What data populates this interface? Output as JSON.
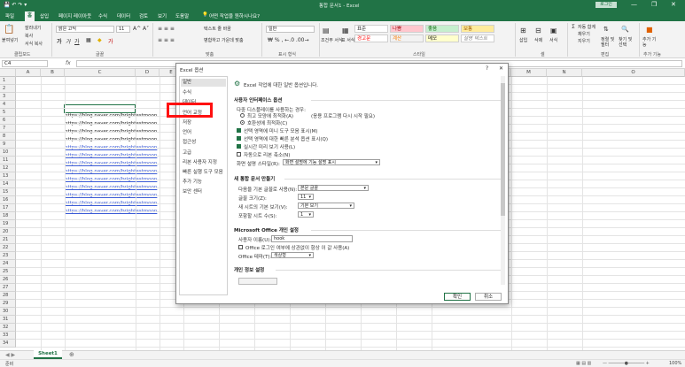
{
  "titlebar": {
    "qa": "💾 ↶ ↷ ▾",
    "title": "통합 문서1 - Excel",
    "login": "로그인",
    "min": "—",
    "max": "❐",
    "close": "✕"
  },
  "tabs": [
    "파일",
    "홈",
    "삽입",
    "페이지 레이아웃",
    "수식",
    "데이터",
    "검토",
    "보기",
    "도움말"
  ],
  "tell_me": "어떤 작업을 원하시나요?",
  "ribbon": {
    "clipboard": {
      "paste": "붙여넣기",
      "cut": "잘라내기",
      "copy": "복사",
      "format_painter": "서식 복사",
      "label": "클립보드"
    },
    "font": {
      "name": "맑은 고딕",
      "size": "11",
      "label": "글꼴"
    },
    "align": {
      "wrap": "텍스트 줄 바꿈",
      "merge": "병합하고 가운데 맞춤",
      "label": "맞춤"
    },
    "number": {
      "format": "일반",
      "label": "표시 형식"
    },
    "styles": {
      "cond": "조건부 서식",
      "table": "표 서식",
      "normal": "표준",
      "bad": "나쁨",
      "good": "좋음",
      "neutral": "보통",
      "warn": "경고문",
      "calc": "계산",
      "memo": "메모",
      "explain": "설명 텍스트",
      "label": "스타일"
    },
    "cells": {
      "insert": "삽입",
      "delete": "삭제",
      "format": "서식",
      "label": "셀"
    },
    "edit": {
      "autosum": "자동 합계",
      "fill": "채우기",
      "clear": "지우기",
      "sort": "정렬 및 필터",
      "find": "찾기 및 선택",
      "label": "편집"
    },
    "addins": {
      "add": "추가 기능",
      "label": "추가 기능"
    }
  },
  "formula": {
    "namebox": "C4",
    "fx": "fx"
  },
  "columns": [
    "A",
    "B",
    "C",
    "D",
    "E",
    "F",
    "G",
    "H",
    "I",
    "J",
    "K",
    "L",
    "M",
    "N",
    "O"
  ],
  "rows": [
    "1",
    "2",
    "3",
    "4",
    "5",
    "6",
    "7",
    "8",
    "9",
    "10",
    "11",
    "12",
    "13",
    "14",
    "15",
    "16",
    "17",
    "18",
    "19",
    "20",
    "21",
    "22",
    "23",
    "24",
    "25",
    "26",
    "27",
    "28",
    "29",
    "30",
    "31",
    "32",
    "33",
    "34"
  ],
  "cells": {
    "link": "https://blog.naver.com/brightestmoon"
  },
  "sheet_tab": "Sheet1",
  "status": {
    "ready": "준비",
    "zoom": "100%"
  },
  "dialog": {
    "title": "Excel 옵션",
    "help": "?",
    "close": "✕",
    "nav": [
      "일반",
      "수식",
      "데이터",
      "언어 교정",
      "저장",
      "언어",
      "접근성",
      "고급",
      "리본 사용자 지정",
      "빠른 실행 도구 모음",
      "추가 기능",
      "보안 센터"
    ],
    "intro": "Excel 작업에 대한 일반 옵션입니다.",
    "ui_header": "사용자 인터페이스 옵션",
    "multi_display": "다중 디스플레이를 사용하는 경우:",
    "opt_appearance": "최고 모양에 최적화(A)",
    "opt_compat": "호환성에 최적화(C)",
    "appearance_note": "(응용 프로그램 다시 시작 필요)",
    "mini_toolbar": "선택 영역에 미니 도구 모음 표시(M)",
    "quick_analysis": "선택 영역에 대한 빠른 분석 옵션 표시(Q)",
    "live_preview": "실시간 미리 보기 사용(L)",
    "collapse_ribbon": "자동으로 리본 축소(N)",
    "screentip_label": "화면 설명 스타일(R):",
    "screentip_value": "화면 설명에 기능 설명 표시",
    "new_wb_header": "새 통합 문서 만들기",
    "font_label": "다음을 기본 글꼴로 사용(N):",
    "font_value": "본문 글꼴",
    "size_label": "글꼴 크기(Z):",
    "size_value": "11",
    "view_label": "새 시트의 기본 보기(V):",
    "view_value": "기본 보기",
    "sheets_label": "포함할 시트 수(S):",
    "sheets_value": "1",
    "office_header": "Microsoft Office 개인 설정",
    "username_label": "사용자 이름(U):",
    "username_value": "hook",
    "always_use": "Office 로그인 여부에 상관없이 항상 이 값 사용(A)",
    "theme_label": "Office 테마(T):",
    "theme_value": "색상형",
    "privacy_header": "개인 정보 설정",
    "ok": "확인",
    "cancel": "취소"
  },
  "colors": {
    "excel_green": "#217346",
    "highlight": "#ff1010",
    "link": "#3b5bd6"
  }
}
